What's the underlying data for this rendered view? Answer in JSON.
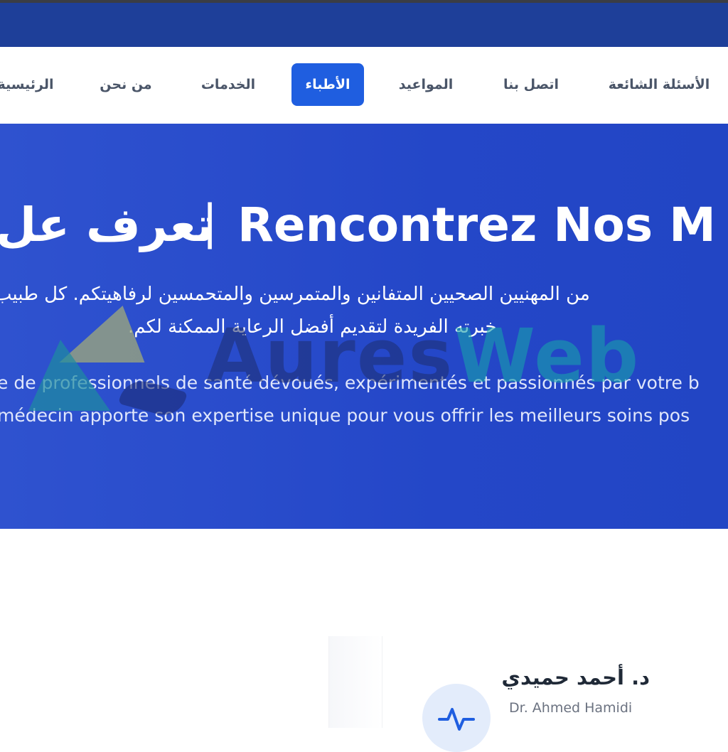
{
  "nav": {
    "items": [
      {
        "label": "الأسئلة الشائعة",
        "active": false
      },
      {
        "label": "اتصل بنا",
        "active": false
      },
      {
        "label": "المواعيد",
        "active": false
      },
      {
        "label": "الأطباء",
        "active": true
      },
      {
        "label": "الخدمات",
        "active": false
      },
      {
        "label": "من نحن",
        "active": false
      },
      {
        "label": "الرئيسية",
        "active": false
      }
    ]
  },
  "hero": {
    "title_ar": "تعرف عل",
    "title_sep": "|",
    "title_fr": "Rencontrez Nos M",
    "desc_ar_line1": "من المهنيين الصحيين المتفانين والمتمرسين والمتحمسين لرفاهيتكم. كل طبيب",
    "desc_ar_line2": "خبرته الفريدة لتقديم أفضل الرعاية الممكنة لكم.",
    "desc_fr_line1": "e de professionnels de santé dévoués, expérimentés et passionnés par votre b",
    "desc_fr_line2": "médecin apporte son expertise unique pour vous offrir les meilleurs soins pos"
  },
  "watermark": {
    "part1": "Aures",
    "part2": "Web"
  },
  "doctor": {
    "name_ar": "د. أحمد حميدي",
    "name_fr": "Dr. Ahmed Hamidi",
    "icon": "heartbeat-icon"
  },
  "colors": {
    "primary": "#1f5ee0",
    "hero_bg": "#2447c8",
    "topbar": "#1e3f99"
  }
}
